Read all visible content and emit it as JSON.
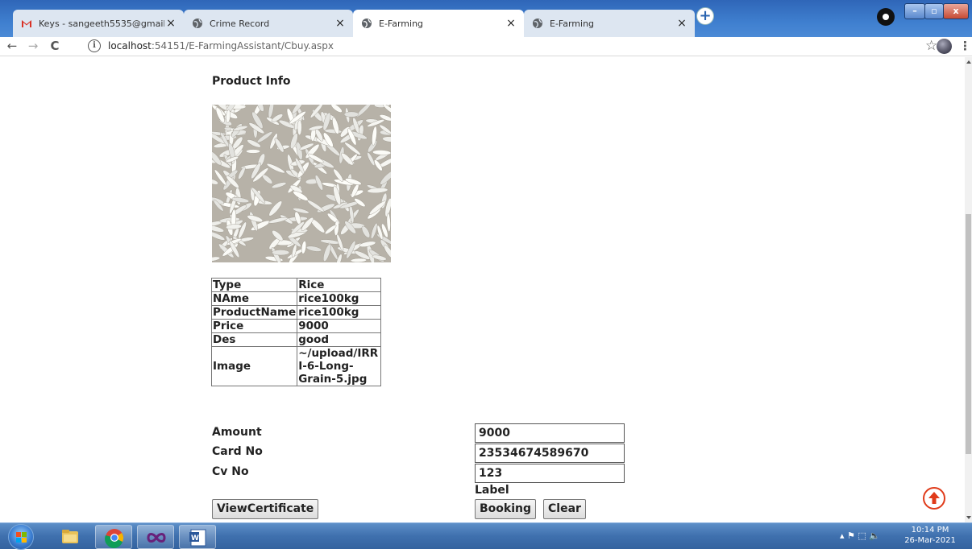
{
  "browser": {
    "tabs": [
      {
        "title": "Keys - sangeeth5535@gmail.com",
        "favicon": "gmail-icon",
        "active": false
      },
      {
        "title": "Crime Record",
        "favicon": "globe-icon",
        "active": false
      },
      {
        "title": "E-Farming",
        "favicon": "globe-icon",
        "active": true
      },
      {
        "title": "E-Farming",
        "favicon": "globe-icon",
        "active": false
      }
    ],
    "close_glyph": "×",
    "new_tab_glyph": "+",
    "window_controls": {
      "minimize": "–",
      "maximize": "▫",
      "close": "x"
    },
    "nav": {
      "back": "←",
      "forward": "→",
      "reload": "C",
      "info": "i"
    },
    "url": {
      "host": "localhost",
      "rest": ":54151/E-FarmingAssistant/Cbuy.aspx"
    },
    "bookmark_glyph": "☆",
    "menu_glyph": "⋮"
  },
  "page": {
    "heading": "Product Info",
    "product_image_alt": "rice grains",
    "details": [
      {
        "key": "Type",
        "value": "Rice"
      },
      {
        "key": "NAme",
        "value": "rice100kg"
      },
      {
        "key": "ProductName",
        "value": "rice100kg"
      },
      {
        "key": "Price",
        "value": "9000"
      },
      {
        "key": "Des",
        "value": "good"
      },
      {
        "key": "Image",
        "value": "~/upload/IRRI-6-Long-Grain-5.jpg"
      }
    ],
    "form": {
      "amount_label": "Amount",
      "amount_value": "9000",
      "card_label": "Card No",
      "card_value": "23534674589670",
      "cv_label": "Cv No",
      "cv_value": "123",
      "status_label": "Label"
    },
    "buttons": {
      "view_certificate": "ViewCertificate",
      "booking": "Booking",
      "clear": "Clear"
    },
    "accent_color": "#e03b1a"
  },
  "taskbar": {
    "pinned": [
      "start-button",
      "file-explorer-icon",
      "chrome-icon",
      "visual-studio-icon",
      "word-icon"
    ],
    "tray_glyphs": "▴  ⚑  ⬚  🔈",
    "time": "10:14 PM",
    "date": "26-Mar-2021"
  }
}
